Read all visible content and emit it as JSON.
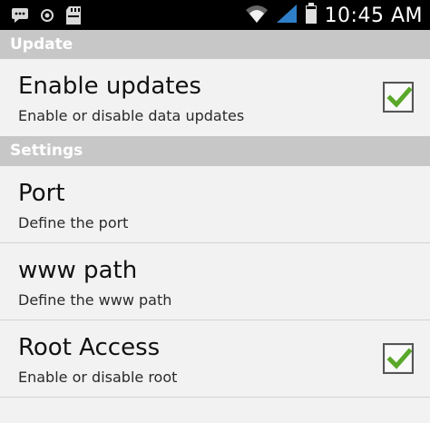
{
  "status_bar": {
    "time": "10:45",
    "ampm": "AM",
    "left_icons": [
      "message-icon",
      "data-sync-icon",
      "sd-card-icon"
    ],
    "right_icons": [
      "wifi-icon",
      "cell-signal-icon",
      "battery-icon"
    ]
  },
  "sections": {
    "update": {
      "header": "Update"
    },
    "settings": {
      "header": "Settings"
    }
  },
  "prefs": {
    "enable_updates": {
      "title": "Enable updates",
      "summary": "Enable or disable data updates",
      "checked": true
    },
    "port": {
      "title": "Port",
      "summary": "Define the port"
    },
    "www_path": {
      "title": "www path",
      "summary": "Define the www path"
    },
    "root_access": {
      "title": "Root Access",
      "summary": "Enable or disable root",
      "checked": true
    }
  },
  "colors": {
    "header_bg": "#c7c7c7",
    "row_bg": "#f2f2f2",
    "check_green": "#5aa82a",
    "status_bar_bg": "#000000"
  }
}
